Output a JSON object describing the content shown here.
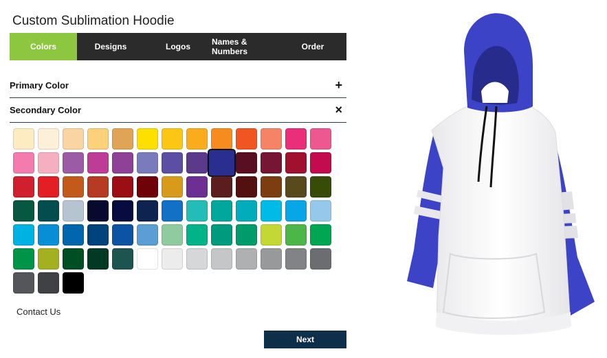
{
  "page_title": "Custom Sublimation Hoodie",
  "tabs": [
    {
      "label": "Colors",
      "active": true
    },
    {
      "label": "Designs",
      "active": false
    },
    {
      "label": "Logos",
      "active": false
    },
    {
      "label": "Names & Numbers",
      "active": false
    },
    {
      "label": "Order",
      "active": false
    }
  ],
  "sections": {
    "primary": {
      "label": "Primary Color",
      "toggle_icon": "plus-icon",
      "toggle_symbol": "+"
    },
    "secondary": {
      "label": "Secondary Color",
      "toggle_icon": "close-icon",
      "toggle_symbol": "×"
    }
  },
  "swatches": [
    [
      "#fdebc1",
      "#fdf0da",
      "#fbd4a4",
      "#fdd07a",
      "#e0a456",
      "#fde000",
      "#fcc614",
      "#fbac1c",
      "#f68c1f",
      "#f05522",
      "#f58466",
      "#ea2e7a",
      "#ee5891"
    ],
    [
      "#f47bae",
      "#f6afc0",
      "#9b5ca5",
      "#bd3c96",
      "#8e4196",
      "#7a7bbd",
      "#5b4ea3",
      "#5b3a8c",
      "#2a2f8f",
      "#5a0e22",
      "#761534",
      "#a0102f",
      "#c30c4e"
    ],
    [
      "#d01f2f",
      "#e31e24",
      "#c25a1c",
      "#b73a22",
      "#9b0f14",
      "#6e0208",
      "#d89a1b",
      "#6d2f91",
      "#5b1e1d",
      "#540f0f",
      "#7c3d10",
      "#584a1d",
      "#364c08"
    ],
    [
      "#065840",
      "#024e4e",
      "#b6c4d2",
      "#07092e",
      "#080b3f",
      "#0f2350",
      "#1270c5",
      "#23bcb6",
      "#01a79d",
      "#02acbb",
      "#00bbe7",
      "#07a7e7",
      "#94c9ec"
    ],
    [
      "#00b2e1",
      "#088ed5",
      "#0166ad",
      "#00437c",
      "#0d53a3",
      "#5b9ed3",
      "#8fcb9e",
      "#02b38a",
      "#009a7e",
      "#009b6a",
      "#c3d835",
      "#4cb748",
      "#00a651"
    ],
    [
      "#009449",
      "#a3b020",
      "#004e24",
      "#003924",
      "#1e5450",
      "#ffffff",
      "#ececec",
      "#d6d7d8",
      "#c4c6c7",
      "#aeb0b2",
      "#97999b",
      "#828386",
      "#6c6d70"
    ],
    [
      "#55565a",
      "#404144",
      "#000000"
    ]
  ],
  "selected_swatch": {
    "row": 1,
    "col": 8
  },
  "footer": {
    "contact_label": "Contact Us",
    "next_label": "Next"
  },
  "preview": {
    "accent_color": "#3d43c6",
    "body_color": "#ffffff"
  }
}
